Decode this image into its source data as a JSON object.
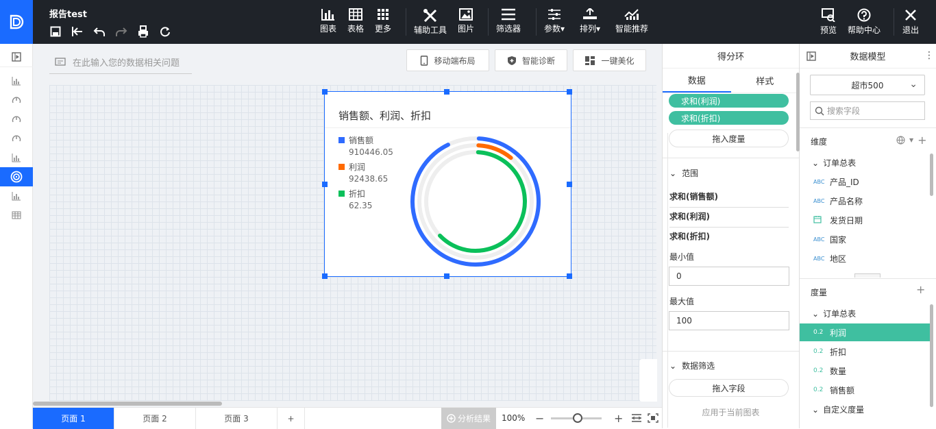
{
  "report": {
    "title": "报告test"
  },
  "toolbar": {
    "chart": "图表",
    "table": "表格",
    "more": "更多",
    "aux_tool": "辅助工具",
    "image": "图片",
    "filter": "筛选器",
    "param": "参数",
    "sort": "排列",
    "smart": "智能推荐",
    "preview": "预览",
    "help": "帮助中心",
    "exit": "退出"
  },
  "question": {
    "placeholder": "在此输入您的数据相关问题"
  },
  "canvas_buttons": {
    "mobile": "移动端布局",
    "diagnose": "智能诊断",
    "beautify": "一键美化"
  },
  "widget": {
    "title": "销售额、利润、折扣",
    "legend": [
      {
        "name": "销售额",
        "value": "910446.05",
        "color": "#2f6bff"
      },
      {
        "name": "利润",
        "value": "92438.65",
        "color": "#ff6a00"
      },
      {
        "name": "折扣",
        "value": "62.35",
        "color": "#0bc05a"
      }
    ]
  },
  "chart_data": {
    "type": "pie",
    "chart_variant": "score-ring",
    "min": 0,
    "max": 100,
    "series": [
      {
        "name": "销售额",
        "value": 910446.05,
        "fill_fraction": 0.92,
        "color": "#2f6bff"
      },
      {
        "name": "利润",
        "value": 92438.65,
        "fill_fraction": 0.1,
        "color": "#ff6a00"
      },
      {
        "name": "折扣",
        "value": 62.35,
        "fill_fraction": 0.62,
        "color": "#0bc05a"
      }
    ],
    "track_color": "#eeeeee"
  },
  "pages": {
    "tabs": [
      "页面 1",
      "页面 2",
      "页面 3"
    ],
    "add": "+",
    "analysis": "分析结果",
    "zoom": "100%"
  },
  "mid_panel": {
    "title": "得分环",
    "tabs": [
      "数据",
      "样式"
    ],
    "measures": [
      "求和(利润)",
      "求和(折扣)"
    ],
    "drop_measure": "拖入度量",
    "range_section": "范围",
    "range_fields": [
      "求和(销售额)",
      "求和(利润)",
      "求和(折扣)"
    ],
    "min_label": "最小值",
    "min_value": "0",
    "max_label": "最大值",
    "max_value": "100",
    "filter_section": "数据筛选",
    "drop_field": "拖入字段",
    "apply_current": "应用于当前图表"
  },
  "right_panel": {
    "title": "数据模型",
    "dataset": "超市500",
    "search_placeholder": "搜索字段",
    "dimension_label": "维度",
    "dimension_group": "订单总表",
    "dimensions": [
      {
        "type": "ABC",
        "name": "产品_ID"
      },
      {
        "type": "ABC",
        "name": "产品名称"
      },
      {
        "type": "date",
        "name": "发货日期"
      },
      {
        "type": "ABC",
        "name": "国家"
      },
      {
        "type": "ABC",
        "name": "地区"
      }
    ],
    "measure_label": "度量",
    "measure_group": "订单总表",
    "measures": [
      {
        "type": "0.2",
        "name": "利润"
      },
      {
        "type": "0.2",
        "name": "折扣"
      },
      {
        "type": "0.2",
        "name": "数量"
      },
      {
        "type": "0.2",
        "name": "销售额"
      }
    ],
    "custom_group": "自定义度量"
  }
}
